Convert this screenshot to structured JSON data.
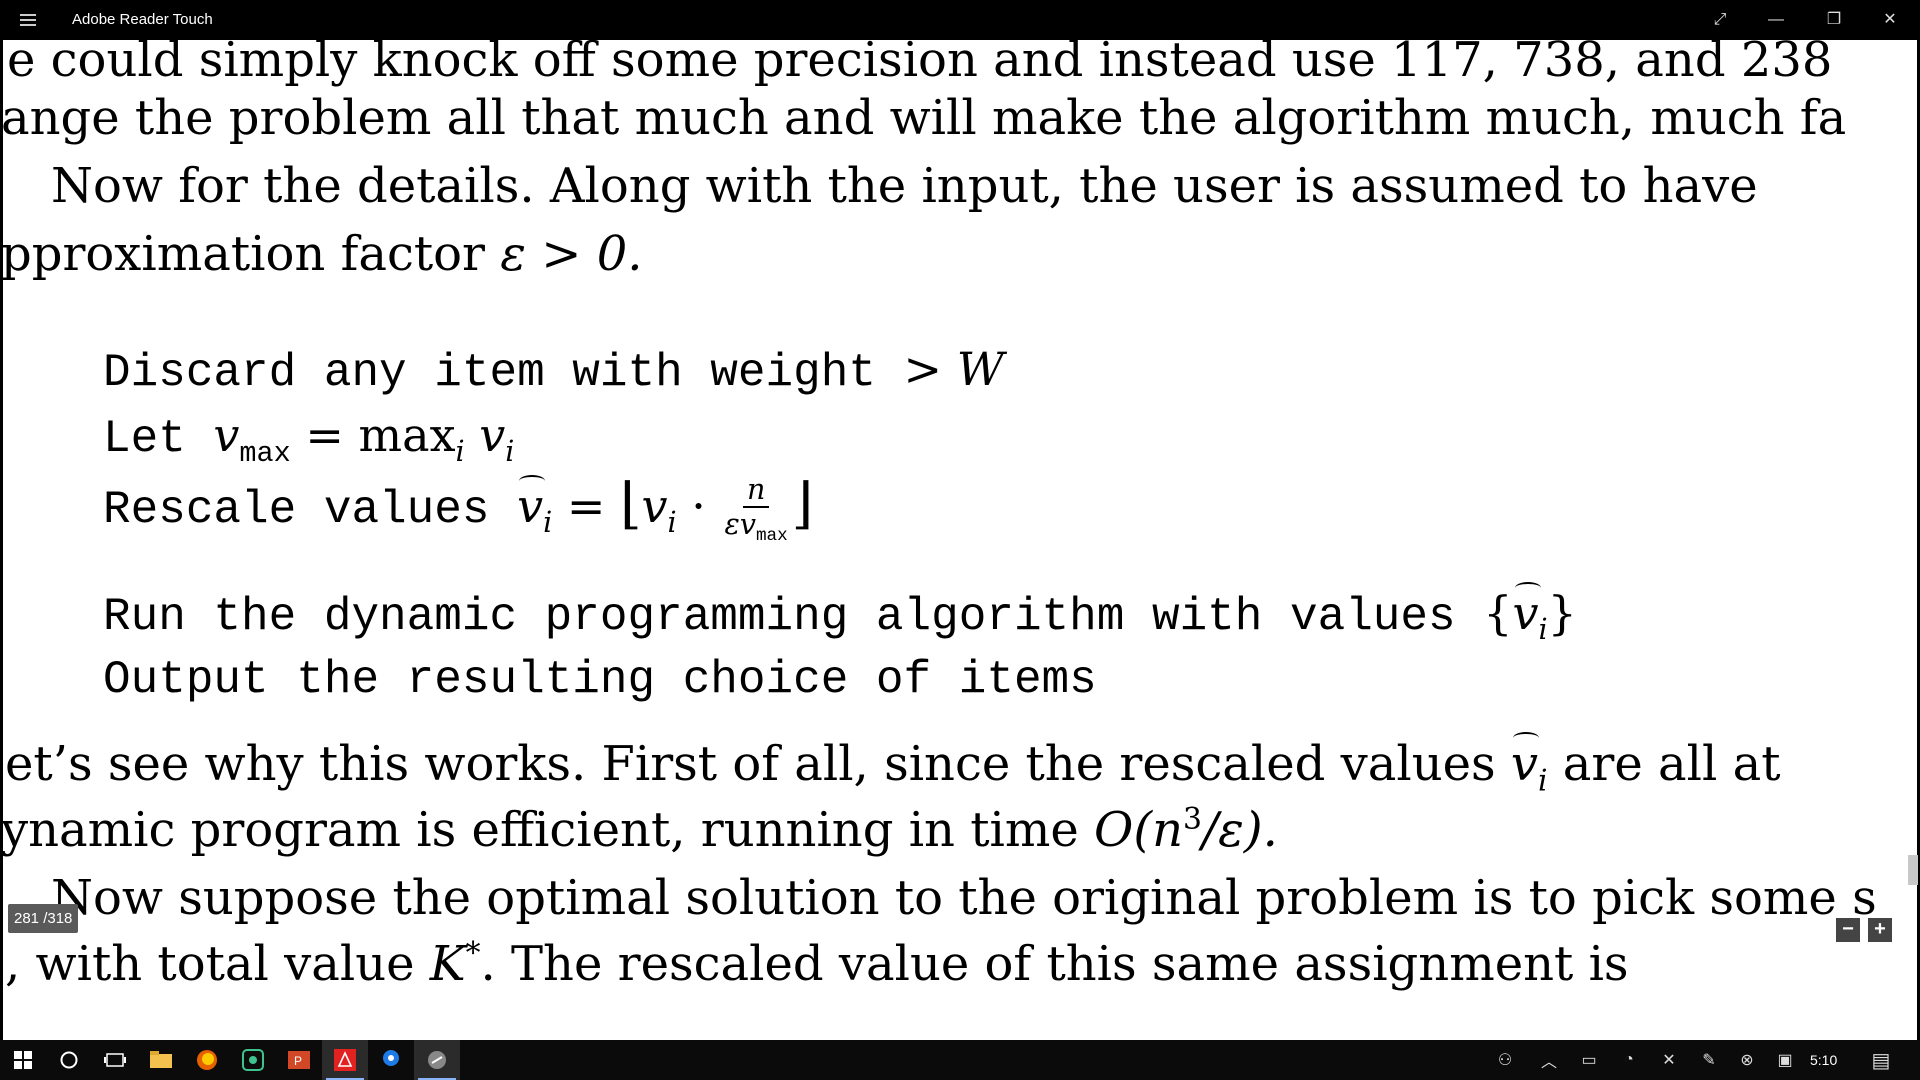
{
  "window": {
    "title": "Adobe Reader Touch",
    "fullscreen_glyph": "⤢",
    "minimize_glyph": "—",
    "restore_glyph": "❐",
    "close_glyph": "✕"
  },
  "document": {
    "lines": [
      "e could simply knock off some precision and instead use 117, 738, and 238",
      "ange the problem all that much and will make the algorithm much, much fa",
      "Now for the details.  Along with the input, the user is assumed to have",
      "pproximation factor "
    ],
    "eps_gt_zero": "ε > 0.",
    "algo": {
      "l1": "Discard any item with weight ",
      "l1_math": "> W",
      "l2": "Let ",
      "l2_var": "v",
      "l2_sub": "max",
      "l2_eq": " = max",
      "l2_i": "i",
      "l2_vi": " v",
      "l2_vi_sub": "i",
      "l3": "Rescale values ",
      "l3_var": "v",
      "l3_sub": "i",
      "l3_eq": " = ",
      "l3_lfloor": "⌊",
      "l3_vi": "v",
      "l3_vi_sub": "i",
      "l3_dot": " · ",
      "l3_num": "n",
      "l3_den": "εv",
      "l3_den_sub": "max",
      "l3_rfloor": "⌋",
      "l4": "Run the dynamic programming algorithm with values ",
      "l4_lbrace": "{",
      "l4_var": "v",
      "l4_sub": "i",
      "l4_rbrace": "}",
      "l5": "Output the resulting choice of items"
    },
    "after": {
      "p1": "et’s see why this works.  First of all, since the rescaled values ",
      "p1_var": "v",
      "p1_sub": "i",
      "p1_tail": " are all at",
      "p2": "ynamic program is efficient, running in time ",
      "p2_math": "O(n",
      "p2_sup": "3",
      "p2_math2": "/ε).",
      "p3": "Now suppose the optimal solution to the original problem is to pick some s",
      "p4a": ", with total value ",
      "p4_k": "K",
      "p4_star": "*",
      "p4b": ". The rescaled value of this same assignment is"
    }
  },
  "page_indicator": "281 /318",
  "zoom": {
    "minus": "−",
    "plus": "+"
  },
  "taskbar": {
    "time": "5:10"
  },
  "colors": {
    "accent": "#8ab4f8",
    "titlebar": "#000000",
    "taskbar": "#0b0b0b"
  }
}
